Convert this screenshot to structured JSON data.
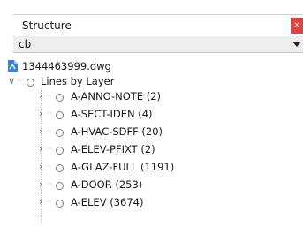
{
  "panel": {
    "title": "Structure",
    "close_label": "x"
  },
  "filter": {
    "value": "cb"
  },
  "tree": {
    "file_label": "1344463999.dwg",
    "group_label": "Lines by Layer",
    "layers": [
      "A-ANNO-NOTE (2)",
      "A-SECT-IDEN (4)",
      "A-HVAC-SDFF (20)",
      "A-ELEV-PFIXT (2)",
      "A-GLAZ-FULL (1191)",
      "A-DOOR (253)",
      "A-ELEV (3674)"
    ]
  }
}
